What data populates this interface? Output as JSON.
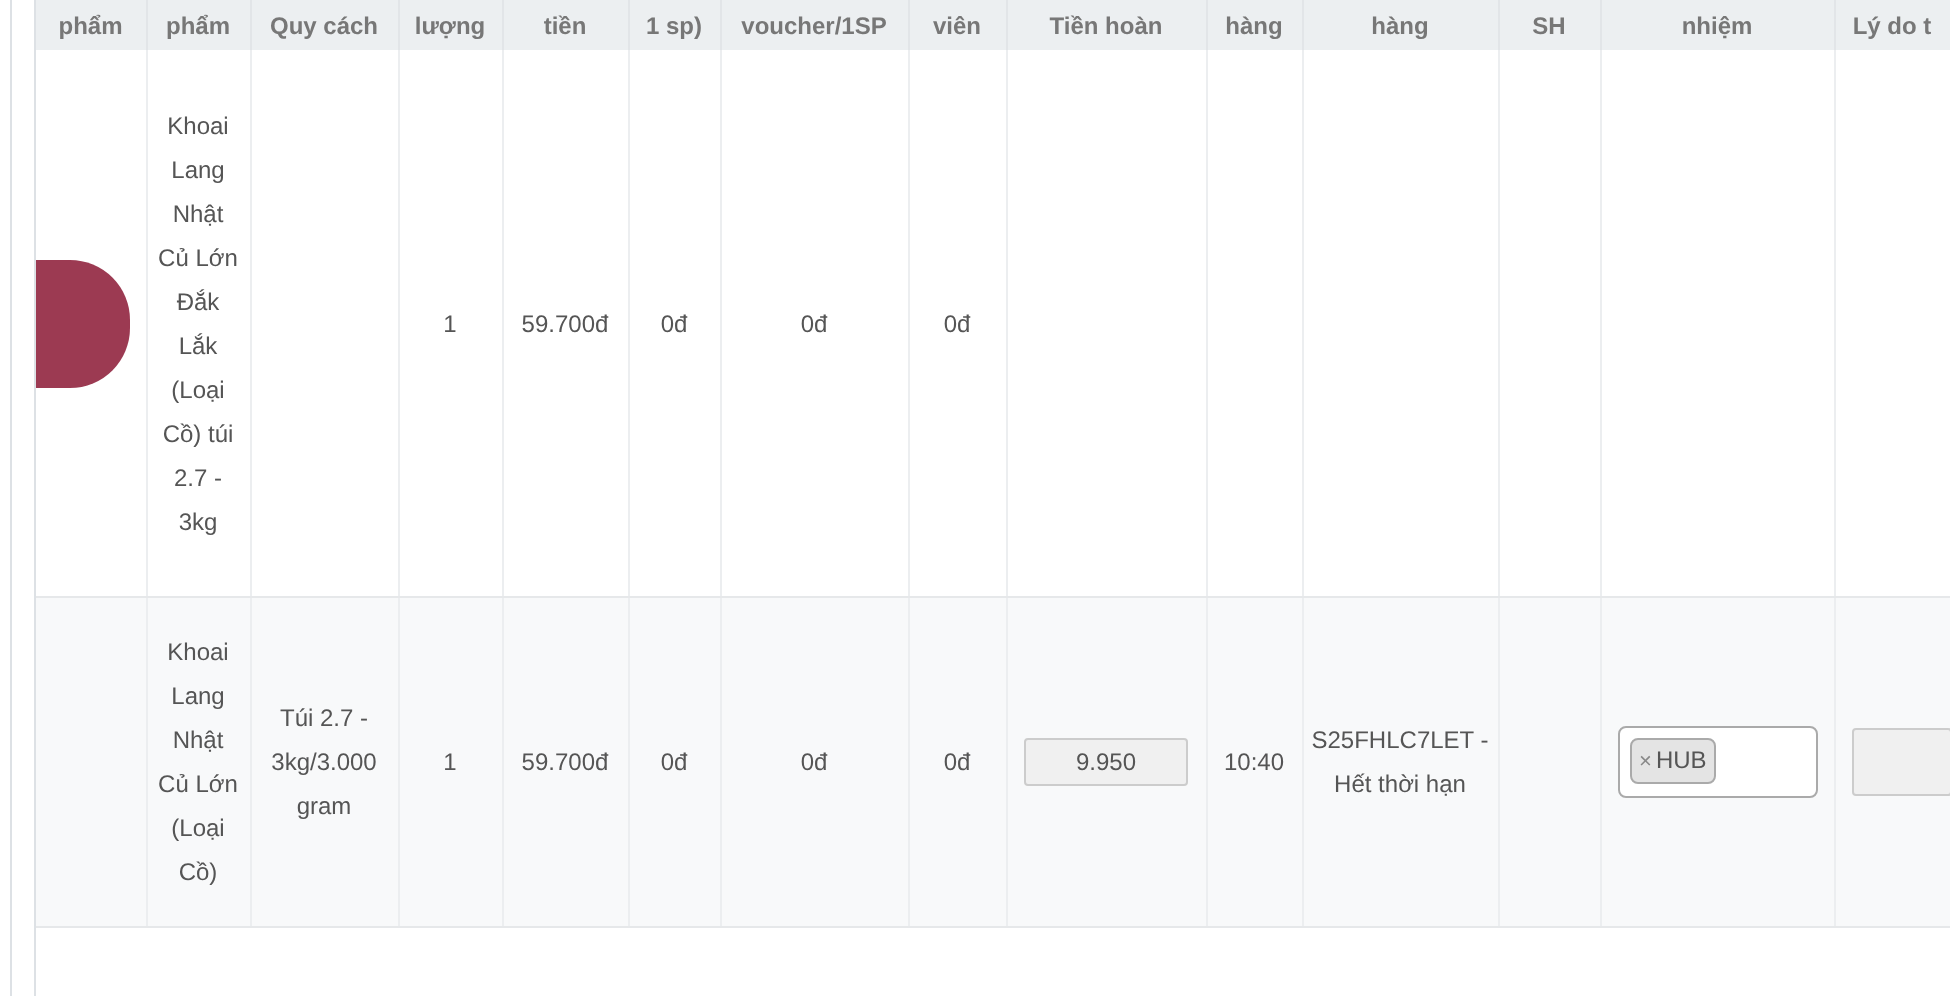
{
  "columns": [
    "phẩm",
    "phẩm",
    "Quy cách",
    "lượng",
    "tiền",
    "1 sp)",
    "voucher/1SP",
    "viên",
    "Tiền hoàn",
    "hàng",
    "hàng",
    "SH",
    "nhiệm",
    "Lý do t"
  ],
  "rows": [
    {
      "cells": [
        {
          "kind": "photo"
        },
        {
          "kind": "text",
          "text": "Khoai Lang Nhật Củ Lớn Đắk Lắk (Loại Cồ) túi 2.7 - 3kg"
        },
        {
          "kind": "empty"
        },
        {
          "kind": "text",
          "text": "1"
        },
        {
          "kind": "text",
          "text": "59.700đ"
        },
        {
          "kind": "text",
          "text": "0đ"
        },
        {
          "kind": "text",
          "text": "0đ"
        },
        {
          "kind": "text",
          "text": "0đ"
        },
        {
          "kind": "empty"
        },
        {
          "kind": "empty"
        },
        {
          "kind": "empty"
        },
        {
          "kind": "empty"
        },
        {
          "kind": "empty"
        },
        {
          "kind": "empty"
        }
      ]
    },
    {
      "cells": [
        {
          "kind": "empty"
        },
        {
          "kind": "text",
          "text": "Khoai Lang Nhật Củ Lớn (Loại Cồ)"
        },
        {
          "kind": "text",
          "text": "Túi 2.7 - 3kg/3.000 gram"
        },
        {
          "kind": "text",
          "text": "1"
        },
        {
          "kind": "text",
          "text": "59.700đ"
        },
        {
          "kind": "text",
          "text": "0đ"
        },
        {
          "kind": "text",
          "text": "0đ"
        },
        {
          "kind": "text",
          "text": "0đ"
        },
        {
          "kind": "input",
          "value": "9.950"
        },
        {
          "kind": "text",
          "text": "10:40"
        },
        {
          "kind": "text",
          "text": "S25FHLC7LET - Hết thời hạn"
        },
        {
          "kind": "empty"
        },
        {
          "kind": "tags",
          "tags": [
            {
              "remove": "×",
              "label": "HUB"
            }
          ]
        },
        {
          "kind": "input"
        }
      ]
    }
  ]
}
